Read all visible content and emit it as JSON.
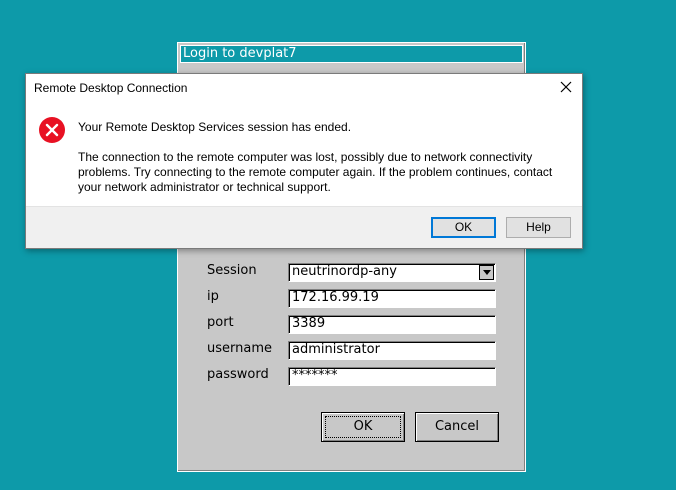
{
  "login": {
    "title": "Login to devplat7",
    "fields": [
      {
        "label": "Session",
        "value": "neutrinordp-any"
      },
      {
        "label": "ip",
        "value": "172.16.99.19"
      },
      {
        "label": "port",
        "value": "3389"
      },
      {
        "label": "username",
        "value": "administrator"
      },
      {
        "label": "password",
        "value": "*******"
      }
    ],
    "ok_label": "OK",
    "cancel_label": "Cancel"
  },
  "dialog": {
    "title": "Remote Desktop Connection",
    "main_message": "Your Remote Desktop Services session has ended.",
    "detail_message": "The connection to the remote computer was lost, possibly due to network connectivity problems. Try connecting to the remote computer again. If the problem continues, contact your network administrator or technical support.",
    "ok_label": "OK",
    "help_label": "Help",
    "icon": "error-icon",
    "error_color": "#e81123"
  },
  "colors": {
    "desktop": "#0d9aa9",
    "window_face": "#c8c8c8",
    "focus_blue": "#0078d7"
  }
}
